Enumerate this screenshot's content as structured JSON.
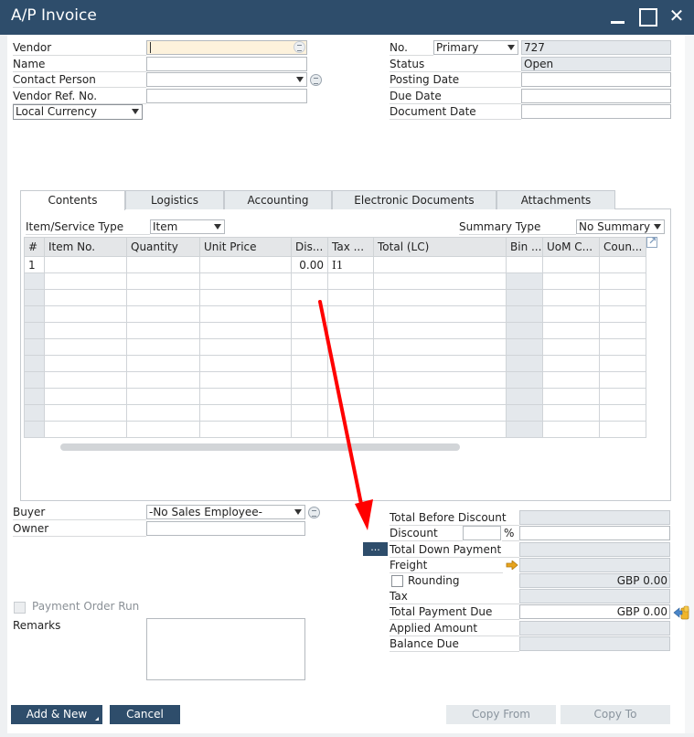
{
  "window": {
    "title": "A/P Invoice",
    "controls": {
      "minimize": "minimize",
      "maximize": "maximize",
      "close": "✕"
    }
  },
  "header_left": {
    "vendor": {
      "label": "Vendor",
      "value": ""
    },
    "name": {
      "label": "Name",
      "value": ""
    },
    "contact_person": {
      "label": "Contact Person",
      "value": ""
    },
    "vendor_ref_no": {
      "label": "Vendor Ref. No.",
      "value": ""
    },
    "currency": {
      "selected": "Local Currency"
    }
  },
  "header_right": {
    "no": {
      "label": "No.",
      "series": "Primary",
      "value": "727"
    },
    "status": {
      "label": "Status",
      "value": "Open"
    },
    "posting_date": {
      "label": "Posting Date",
      "value": ""
    },
    "due_date": {
      "label": "Due Date",
      "value": ""
    },
    "document_date": {
      "label": "Document Date",
      "value": ""
    }
  },
  "tabs": [
    {
      "label": "Contents",
      "active": true
    },
    {
      "label": "Logistics",
      "active": false
    },
    {
      "label": "Accounting",
      "active": false
    },
    {
      "label": "Electronic Documents",
      "active": false
    },
    {
      "label": "Attachments",
      "active": false
    }
  ],
  "contents": {
    "item_service_type": {
      "label": "Item/Service Type",
      "selected": "Item"
    },
    "summary_type": {
      "label": "Summary Type",
      "selected": "No Summary"
    },
    "columns": [
      "#",
      "Item No.",
      "Quantity",
      "Unit Price",
      "Dis...",
      "Tax ...",
      "Total (LC)",
      "Bin ...",
      "UoM C...",
      "Coun..."
    ],
    "rows": [
      [
        "1",
        "",
        "",
        "",
        "0.00",
        "I1",
        "",
        "",
        "",
        ""
      ],
      [
        "",
        "",
        "",
        "",
        "",
        "",
        "",
        "",
        "",
        ""
      ],
      [
        "",
        "",
        "",
        "",
        "",
        "",
        "",
        "",
        "",
        ""
      ],
      [
        "",
        "",
        "",
        "",
        "",
        "",
        "",
        "",
        "",
        ""
      ],
      [
        "",
        "",
        "",
        "",
        "",
        "",
        "",
        "",
        "",
        ""
      ],
      [
        "",
        "",
        "",
        "",
        "",
        "",
        "",
        "",
        "",
        ""
      ],
      [
        "",
        "",
        "",
        "",
        "",
        "",
        "",
        "",
        "",
        ""
      ],
      [
        "",
        "",
        "",
        "",
        "",
        "",
        "",
        "",
        "",
        ""
      ],
      [
        "",
        "",
        "",
        "",
        "",
        "",
        "",
        "",
        "",
        ""
      ],
      [
        "",
        "",
        "",
        "",
        "",
        "",
        "",
        "",
        "",
        ""
      ],
      [
        "",
        "",
        "",
        "",
        "",
        "",
        "",
        "",
        "",
        ""
      ]
    ]
  },
  "footer_left": {
    "buyer": {
      "label": "Buyer",
      "selected": "-No Sales Employee-"
    },
    "owner": {
      "label": "Owner",
      "value": ""
    },
    "payment_order_run": {
      "label": "Payment Order Run",
      "checked": false,
      "disabled": true
    },
    "remarks": {
      "label": "Remarks",
      "value": ""
    }
  },
  "totals": {
    "more_button": "...",
    "total_before_discount": {
      "label": "Total Before Discount",
      "value": ""
    },
    "discount": {
      "label": "Discount",
      "percent": "",
      "percent_sign": "%",
      "value": ""
    },
    "total_down_payment": {
      "label": "Total Down Payment",
      "value": ""
    },
    "freight": {
      "label": "Freight",
      "value": ""
    },
    "rounding": {
      "label": "Rounding",
      "checked": false,
      "value": "GBP 0.00"
    },
    "tax": {
      "label": "Tax",
      "value": ""
    },
    "total_payment_due": {
      "label": "Total Payment Due",
      "value": "GBP 0.00"
    },
    "applied_amount": {
      "label": "Applied Amount",
      "value": ""
    },
    "balance_due": {
      "label": "Balance Due",
      "value": ""
    }
  },
  "buttons": {
    "add_new": "Add & New",
    "cancel": "Cancel",
    "copy_from": "Copy From",
    "copy_to": "Copy To"
  },
  "annotation": {
    "arrow_color": "#ff0000"
  },
  "colors": {
    "brand": "#2e4d6b",
    "readonly_field": "#e4e8ec",
    "focus_field": "#fdf2dc"
  }
}
